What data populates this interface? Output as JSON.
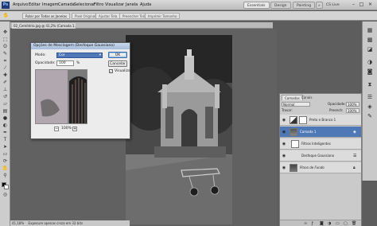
{
  "app": {
    "logo_text": "Ps"
  },
  "menu": [
    "Arquivo",
    "Editar",
    "Imagem",
    "Camada",
    "Selecionar",
    "Filtro",
    "Visualizar",
    "Janela",
    "Ajuda"
  ],
  "workspace": {
    "active": "Essentials",
    "others": [
      "Design",
      "Painting"
    ],
    "more": "»",
    "cs_live": "CS Live"
  },
  "options_bar": {
    "buttons": [
      "Rolar por Todas as Janelas",
      "Pixel Original",
      "Ajustar Tela",
      "Preencher Tela",
      "Imprimir Tamanho"
    ]
  },
  "document": {
    "tab_label": "02_Cemitério.jpg @ 41,2% (Camada 1, RGB/8)"
  },
  "status_bar": {
    "zoom": "41,18%",
    "info": "Exposure apenas cinza em 32 bits"
  },
  "dialog": {
    "title": "Opções de Mesclagem (Desfoque Gaussiano)",
    "mode_label": "Modo:",
    "mode_value": "Cor",
    "opacity_label": "Opacidade:",
    "opacity_value": "100",
    "opacity_unit": "%",
    "ok_label": "OK",
    "cancel_label": "Cancelar",
    "preview_label": "Visualizar",
    "preview_checked": true,
    "zoom_label": "100%"
  },
  "layers_panel": {
    "tabs": [
      "Camadas",
      "Canais"
    ],
    "blend_mode": "Normal",
    "opacity_label": "Opacidade:",
    "opacity_value": "100%",
    "lock_label": "Travar:",
    "fill_label": "Preench:",
    "fill_value": "100%",
    "layers": [
      {
        "name": "Preto e Branco 1",
        "selected": false,
        "visible": true
      },
      {
        "name": "Camada 1",
        "selected": true,
        "visible": true
      },
      {
        "name": "Filtros Inteligentes",
        "selected": false,
        "visible": true
      },
      {
        "name": "Desfoque Gaussiano",
        "selected": false,
        "visible": true
      },
      {
        "name": "Plano de Fundo",
        "selected": false,
        "visible": true
      }
    ]
  },
  "colors": {
    "selection": "#4f79b6",
    "titlebar": "#c9c9c9",
    "canvas_bg": "#616161"
  }
}
